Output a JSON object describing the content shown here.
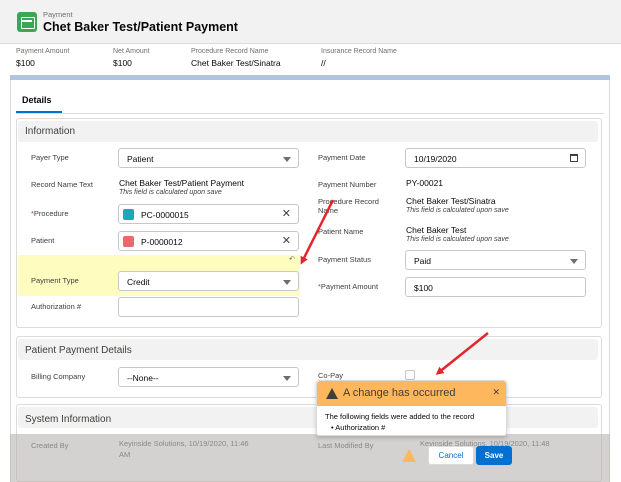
{
  "header": {
    "object_label": "Payment",
    "record_title": "Chet Baker Test/Patient Payment",
    "highlights": [
      {
        "label": "Payment Amount",
        "value": "$100"
      },
      {
        "label": "Net Amount",
        "value": "$100"
      },
      {
        "label": "Procedure Record Name",
        "value": "Chet Baker Test/Sinatra"
      },
      {
        "label": "Insurance Record Name",
        "value": "//"
      }
    ]
  },
  "tabs": {
    "details": "Details"
  },
  "information": {
    "title": "Information",
    "payer_type": {
      "label": "Payer Type",
      "value": "Patient"
    },
    "record_name_text": {
      "label": "Record Name Text",
      "value": "Chet Baker Test/Patient Payment",
      "note": "This field is calculated upon save"
    },
    "procedure": {
      "label": "Procedure",
      "value": "PC-0000015"
    },
    "patient": {
      "label": "Patient",
      "value": "P-0000012"
    },
    "payment_type": {
      "label": "Payment Type",
      "value": "Credit"
    },
    "authorization": {
      "label": "Authorization #",
      "value": ""
    },
    "payment_date": {
      "label": "Payment Date",
      "value": "10/19/2020"
    },
    "payment_number": {
      "label": "Payment Number",
      "value": "PY-00021"
    },
    "procedure_record_name": {
      "label": "Procedure Record Name",
      "value": "Chet Baker Test/Sinatra",
      "note": "This field is calculated upon save"
    },
    "patient_name": {
      "label": "Patient Name",
      "value": "Chet Baker Test",
      "note": "This field is calculated upon save"
    },
    "payment_status": {
      "label": "Payment Status",
      "value": "Paid"
    },
    "payment_amount": {
      "label": "Payment Amount",
      "value": "$100"
    }
  },
  "patient_payment_details": {
    "title": "Patient Payment Details",
    "billing_company": {
      "label": "Billing Company",
      "value": "--None--"
    },
    "co_pay": {
      "label": "Co-Pay"
    }
  },
  "system_information": {
    "title": "System Information",
    "created_by_label": "Created By",
    "created_by_value": "Keyinside Solutions, 10/19/2020, 11:46",
    "created_by_value2": "AM",
    "last_modified_label": "Last Modified By",
    "last_modified_value": "Keyinside Solutions, 10/19/2020, 11:48"
  },
  "popover": {
    "title": "A change has occurred",
    "body": "The following fields were added to the record",
    "items": [
      "Authorization #"
    ]
  },
  "footer": {
    "cancel": "Cancel",
    "save": "Save"
  },
  "colors": {
    "accent": "#0070d2",
    "warning": "#ffb75d",
    "highlight": "#fefcbf",
    "arrow": "#e3262b",
    "icon_green": "#3ba755"
  }
}
